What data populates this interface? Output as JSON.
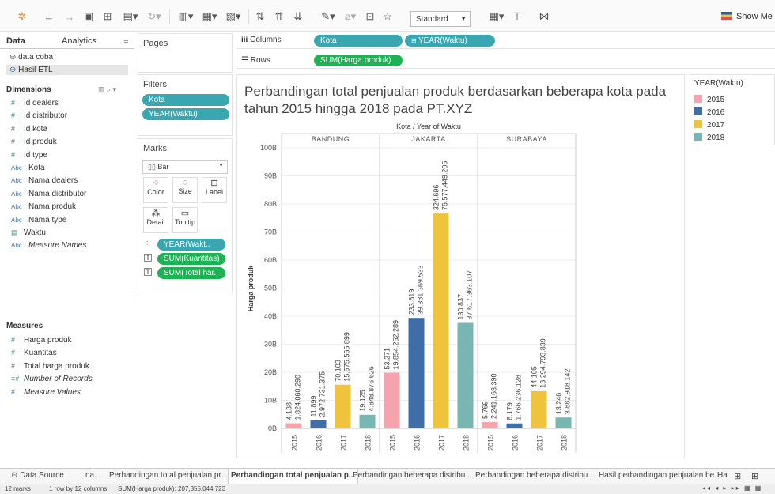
{
  "toolbar": {
    "standard": "Standard",
    "show_me": "Show Me"
  },
  "left": {
    "tab_data": "Data",
    "tab_analytics": "Analytics",
    "sources": [
      "data coba",
      "Hasil ETL"
    ],
    "dimensions_title": "Dimensions",
    "dimensions": [
      {
        "type": "#",
        "name": "Id dealers"
      },
      {
        "type": "#",
        "name": "Id distributor"
      },
      {
        "type": "#",
        "name": "Id kota"
      },
      {
        "type": "#",
        "name": "Id produk"
      },
      {
        "type": "#",
        "name": "Id type"
      },
      {
        "type": "Abc",
        "name": "Kota"
      },
      {
        "type": "Abc",
        "name": "Nama dealers"
      },
      {
        "type": "Abc",
        "name": "Nama distributor"
      },
      {
        "type": "Abc",
        "name": "Nama produk"
      },
      {
        "type": "Abc",
        "name": "Nama type"
      },
      {
        "type": "cal",
        "name": "Waktu"
      },
      {
        "type": "Abc",
        "name": "Measure Names"
      }
    ],
    "measures_title": "Measures",
    "measures": [
      {
        "type": "#",
        "name": "Harga produk"
      },
      {
        "type": "#",
        "name": "Kuantitas"
      },
      {
        "type": "#",
        "name": "Total harga produk"
      },
      {
        "type": "=#",
        "name": "Number of Records"
      },
      {
        "type": "#",
        "name": "Measure Values"
      }
    ]
  },
  "shelves": {
    "pages": "Pages",
    "filters": "Filters",
    "filter_pills": [
      "Kota",
      "YEAR(Waktu)"
    ],
    "marks": "Marks",
    "mark_type": "Bar",
    "mark_buttons": [
      "Color",
      "Size",
      "Label",
      "Detail",
      "Tooltip"
    ],
    "mark_pills": [
      "YEAR(Wakt..",
      "SUM(Kuantitas)",
      "SUM(Total har.."
    ],
    "columns": "Columns",
    "rows": "Rows",
    "column_pills": [
      "Kota",
      "YEAR(Waktu)"
    ],
    "row_pills": [
      "SUM(Harga produk)"
    ]
  },
  "chart_data": {
    "type": "bar",
    "title": "Perbandingan total penjualan produk berdasarkan beberapa kota pada tahun 2015 hingga 2018 pada PT.XYZ",
    "header": "Kota / Year of Waktu",
    "ylabel": "Harga produk",
    "ylim": [
      0,
      100
    ],
    "y_ticks": [
      "0B",
      "10B",
      "20B",
      "30B",
      "40B",
      "50B",
      "60B",
      "70B",
      "80B",
      "90B",
      "100B"
    ],
    "groups": [
      {
        "name": "BANDUNG",
        "bars": [
          {
            "year": "2015",
            "value": 1.824,
            "label1": "4.138",
            "label2": "1.824.060.290"
          },
          {
            "year": "2016",
            "value": 2.973,
            "label1": "11.899",
            "label2": "2.972.731.375"
          },
          {
            "year": "2017",
            "value": 15.576,
            "label1": "70.103",
            "label2": "15.575.565.899"
          },
          {
            "year": "2018",
            "value": 4.849,
            "label1": "19.125",
            "label2": "4.848.876.626"
          }
        ]
      },
      {
        "name": "JAKARTA",
        "bars": [
          {
            "year": "2015",
            "value": 19.854,
            "label1": "53.271",
            "label2": "19.854.252.289"
          },
          {
            "year": "2016",
            "value": 39.381,
            "label1": "233.819",
            "label2": "39.381.369.533"
          },
          {
            "year": "2017",
            "value": 76.577,
            "label1": "324.696",
            "label2": "76.577.449.205"
          },
          {
            "year": "2018",
            "value": 37.617,
            "label1": "130.837",
            "label2": "37.617.363.107"
          }
        ]
      },
      {
        "name": "SURABAYA",
        "bars": [
          {
            "year": "2015",
            "value": 2.241,
            "label1": "5.769",
            "label2": "2.241.163.390"
          },
          {
            "year": "2016",
            "value": 1.766,
            "label1": "8.179",
            "label2": "1.766.236.128"
          },
          {
            "year": "2017",
            "value": 13.295,
            "label1": "44.105",
            "label2": "13.294.793.839"
          },
          {
            "year": "2018",
            "value": 3.883,
            "label1": "13.246",
            "label2": "3.882.918.142"
          }
        ]
      }
    ],
    "colors": {
      "2015": "#f5a3ad",
      "2016": "#3f6ea6",
      "2017": "#f0c33c",
      "2018": "#76b7b2"
    },
    "legend_title": "YEAR(Waktu)",
    "legend": [
      "2015",
      "2016",
      "2017",
      "2018"
    ]
  },
  "tabs": [
    "Data Source",
    "na...",
    "Perbandingan total penjualan pr...",
    "Perbandingan total penjualan p...",
    "Perbandingan beberapa distribu...",
    "Perbandingan beberapa distribu...",
    "Hasil perbandingan penjualan be...",
    "Ha"
  ],
  "status": {
    "marks": "12 marks",
    "rows": "1 row by 12 columns",
    "sum": "SUM(Harga produk): 207,355,044,723"
  }
}
